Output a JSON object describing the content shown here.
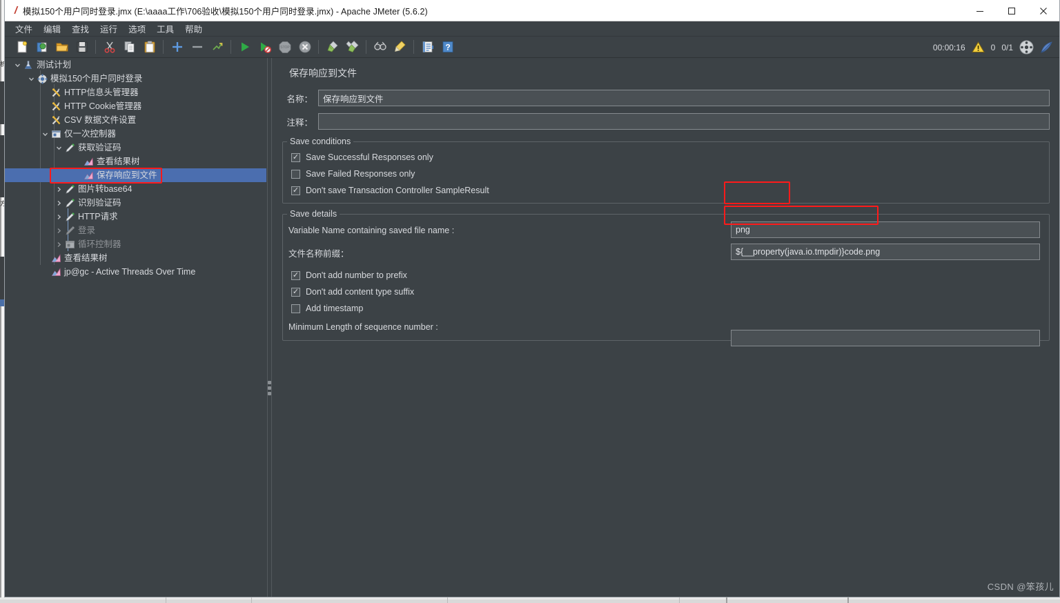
{
  "window": {
    "title": "模拟150个用户同时登录.jmx (E:\\aaaa工作\\706验收\\模拟150个用户同时登录.jmx) - Apache JMeter (5.6.2)",
    "app_icon": "jmeter-feather-icon",
    "controls": {
      "minimize": "minimize-icon",
      "maximize": "maximize-icon",
      "close": "close-icon"
    }
  },
  "menubar": {
    "items": [
      {
        "label": "文件"
      },
      {
        "label": "编辑"
      },
      {
        "label": "查找"
      },
      {
        "label": "运行"
      },
      {
        "label": "选项"
      },
      {
        "label": "工具"
      },
      {
        "label": "帮助"
      }
    ]
  },
  "toolbar": {
    "buttons": [
      {
        "name": "new-icon",
        "title": "新建"
      },
      {
        "name": "templates-icon",
        "title": "模板"
      },
      {
        "name": "open-icon",
        "title": "打开"
      },
      {
        "name": "save-icon",
        "title": "保存"
      },
      {
        "name": "cut-icon",
        "title": "剪切"
      },
      {
        "name": "copy-icon",
        "title": "复制"
      },
      {
        "name": "paste-icon",
        "title": "粘贴"
      },
      {
        "name": "expand-all-icon",
        "title": "展开全部"
      },
      {
        "name": "collapse-all-icon",
        "title": "折叠全部"
      },
      {
        "name": "toggle-icon",
        "title": "启用/禁用"
      },
      {
        "name": "start-icon",
        "title": "启动"
      },
      {
        "name": "start-no-timers-icon",
        "title": "无间隔启动"
      },
      {
        "name": "stop-icon",
        "title": "停止"
      },
      {
        "name": "shutdown-icon",
        "title": "关闭"
      },
      {
        "name": "clear-icon",
        "title": "清除"
      },
      {
        "name": "clear-all-icon",
        "title": "清除全部"
      },
      {
        "name": "search-icon",
        "title": "查找"
      },
      {
        "name": "reset-search-icon",
        "title": "重置查找"
      },
      {
        "name": "function-helper-icon",
        "title": "函数助手"
      },
      {
        "name": "help-icon",
        "title": "帮助"
      }
    ],
    "status": {
      "elapsed": "00:00:16",
      "warning_icon": "warning-triangle-icon",
      "warning_count": "0",
      "threads": "0/1",
      "remote_icon": "remote-engines-icon",
      "feather_icon": "jmeter-feather-small-icon"
    }
  },
  "tree": {
    "nodes": [
      {
        "label": "测试计划",
        "icon": "test-plan-icon",
        "indent": 0,
        "twisty": "down",
        "state": "normal"
      },
      {
        "label": "模拟150个用户同时登录",
        "icon": "thread-group-icon",
        "indent": 1,
        "twisty": "down",
        "state": "normal"
      },
      {
        "label": "HTTP信息头管理器",
        "icon": "config-element-icon",
        "indent": 2,
        "twisty": "none",
        "state": "normal"
      },
      {
        "label": "HTTP Cookie管理器",
        "icon": "config-element-icon",
        "indent": 2,
        "twisty": "none",
        "state": "normal"
      },
      {
        "label": "CSV 数据文件设置",
        "icon": "config-element-icon",
        "indent": 2,
        "twisty": "none",
        "state": "normal"
      },
      {
        "label": "仅一次控制器",
        "icon": "controller-icon",
        "indent": 2,
        "twisty": "down",
        "state": "normal"
      },
      {
        "label": "获取验证码",
        "icon": "http-sampler-icon",
        "indent": 3,
        "twisty": "down",
        "state": "normal"
      },
      {
        "label": "查看结果树",
        "icon": "listener-icon",
        "indent": 4,
        "twisty": "none",
        "state": "normal"
      },
      {
        "label": "保存响应到文件",
        "icon": "listener-icon",
        "indent": 4,
        "twisty": "none",
        "state": "selected"
      },
      {
        "label": "图片转base64",
        "icon": "http-sampler-icon",
        "indent": 3,
        "twisty": "right",
        "state": "normal"
      },
      {
        "label": "识别验证码",
        "icon": "http-sampler-icon",
        "indent": 3,
        "twisty": "right",
        "state": "normal"
      },
      {
        "label": "HTTP请求",
        "icon": "http-sampler-icon",
        "indent": 3,
        "twisty": "right",
        "state": "normal"
      },
      {
        "label": "登录",
        "icon": "http-sampler-disabled-icon",
        "indent": 3,
        "twisty": "right",
        "state": "disabled"
      },
      {
        "label": "循环控制器",
        "icon": "controller-disabled-icon",
        "indent": 3,
        "twisty": "right",
        "state": "disabled"
      },
      {
        "label": "查看结果树",
        "icon": "listener-icon",
        "indent": 2,
        "twisty": "none",
        "state": "normal"
      },
      {
        "label": "jp@gc - Active Threads Over Time",
        "icon": "listener-icon",
        "indent": 2,
        "twisty": "none",
        "state": "normal"
      }
    ]
  },
  "editor": {
    "panel_title": "保存响应到文件",
    "name": {
      "label": "名称：",
      "value": "保存响应到文件"
    },
    "comment": {
      "label": "注释：",
      "value": ""
    },
    "save_conditions": {
      "legend": "Save conditions",
      "items": [
        {
          "label": "Save Successful Responses only",
          "checked": true
        },
        {
          "label": "Save Failed Responses only",
          "checked": false
        },
        {
          "label": "Don't save Transaction Controller SampleResult",
          "checked": true
        }
      ]
    },
    "save_details": {
      "legend": "Save details",
      "variable_name_label": "Variable Name containing saved file name :",
      "variable_name_value": "png",
      "filename_prefix_label": "文件名称前缀：",
      "filename_prefix_value": "${__property(java.io.tmpdir)}code.png",
      "items": [
        {
          "label": "Don't add number to prefix",
          "checked": true
        },
        {
          "label": "Don't add content type suffix",
          "checked": true
        },
        {
          "label": "Add timestamp",
          "checked": false
        }
      ],
      "min_length_label": "Minimum Length of sequence number :",
      "min_length_value": ""
    }
  },
  "annotations": {
    "highlight_color": "#ff1a1a",
    "boxes": [
      {
        "name": "tree-selected-node-highlight"
      },
      {
        "name": "variable-name-field-highlight"
      },
      {
        "name": "filename-prefix-field-highlight"
      }
    ]
  },
  "watermark": {
    "text": "CSDN @笨孩儿"
  }
}
